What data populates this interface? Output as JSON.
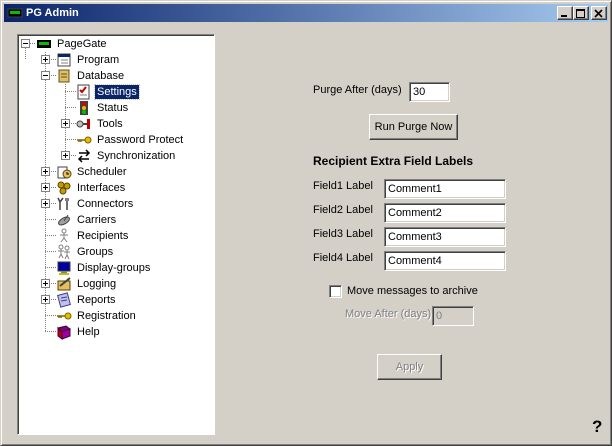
{
  "window": {
    "title": "PG Admin",
    "controls": {
      "minimize": "minimize",
      "maximize": "maximize",
      "close": "close"
    }
  },
  "tree": {
    "root": {
      "label": "PageGate",
      "icon": "pagegate-icon",
      "expanded": true
    },
    "items": [
      {
        "label": "Program",
        "icon": "program-icon",
        "expander": "plus"
      },
      {
        "label": "Database",
        "icon": "database-icon",
        "expander": "minus"
      },
      {
        "label": "Settings",
        "icon": "settings-icon",
        "selected": true
      },
      {
        "label": "Status",
        "icon": "status-icon"
      },
      {
        "label": "Tools",
        "icon": "tools-icon",
        "expander": "plus"
      },
      {
        "label": "Password Protect",
        "icon": "key-icon"
      },
      {
        "label": "Synchronization",
        "icon": "sync-icon",
        "expander": "plus"
      },
      {
        "label": "Scheduler",
        "icon": "scheduler-icon",
        "expander": "plus"
      },
      {
        "label": "Interfaces",
        "icon": "interfaces-icon",
        "expander": "plus"
      },
      {
        "label": "Connectors",
        "icon": "connectors-icon",
        "expander": "plus"
      },
      {
        "label": "Carriers",
        "icon": "carriers-icon"
      },
      {
        "label": "Recipients",
        "icon": "recipients-icon"
      },
      {
        "label": "Groups",
        "icon": "groups-icon"
      },
      {
        "label": "Display-groups",
        "icon": "display-groups-icon"
      },
      {
        "label": "Logging",
        "icon": "logging-icon",
        "expander": "plus"
      },
      {
        "label": "Reports",
        "icon": "reports-icon",
        "expander": "plus"
      },
      {
        "label": "Registration",
        "icon": "key-icon"
      },
      {
        "label": "Help",
        "icon": "help-book-icon"
      }
    ]
  },
  "settings": {
    "purge_label": "Purge After (days)",
    "purge_value": "30",
    "run_purge_label": "Run Purge Now",
    "section_title": "Recipient Extra Field Labels",
    "fields": [
      {
        "label": "Field1 Label",
        "value": "Comment1"
      },
      {
        "label": "Field2 Label",
        "value": "Comment2"
      },
      {
        "label": "Field3 Label",
        "value": "Comment3"
      },
      {
        "label": "Field4 Label",
        "value": "Comment4"
      }
    ],
    "archive_checkbox_label": "Move messages to archive",
    "archive_checked": false,
    "move_after_label": "Move After (days)",
    "move_after_value": "0",
    "apply_label": "Apply"
  },
  "help_button": "?",
  "colors": {
    "titlebar_start": "#0a246a",
    "titlebar_end": "#a6caf0",
    "face": "#d4d0c8",
    "selection": "#0a246a"
  }
}
